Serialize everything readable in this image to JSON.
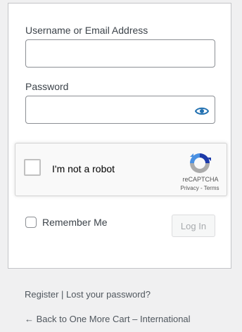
{
  "form": {
    "username_label": "Username or Email Address",
    "username_value": "",
    "password_label": "Password",
    "password_value": "",
    "show_password_icon": "eye-icon"
  },
  "recaptcha": {
    "label": "I'm not a robot",
    "brand": "reCAPTCHA",
    "privacy": "Privacy",
    "separator": " - ",
    "terms": "Terms"
  },
  "remember": {
    "label": "Remember Me",
    "checked": false
  },
  "login_button": "Log In",
  "nav": {
    "register": "Register",
    "separator": " | ",
    "lost_password": "Lost your password?",
    "back": "← Back to One More Cart – International"
  },
  "colors": {
    "accent": "#2271b1",
    "background": "#f0f0f1",
    "recaptcha_blue": "#1c3aa9",
    "recaptcha_light_blue": "#4a90e2",
    "recaptcha_gray": "#ababab"
  }
}
